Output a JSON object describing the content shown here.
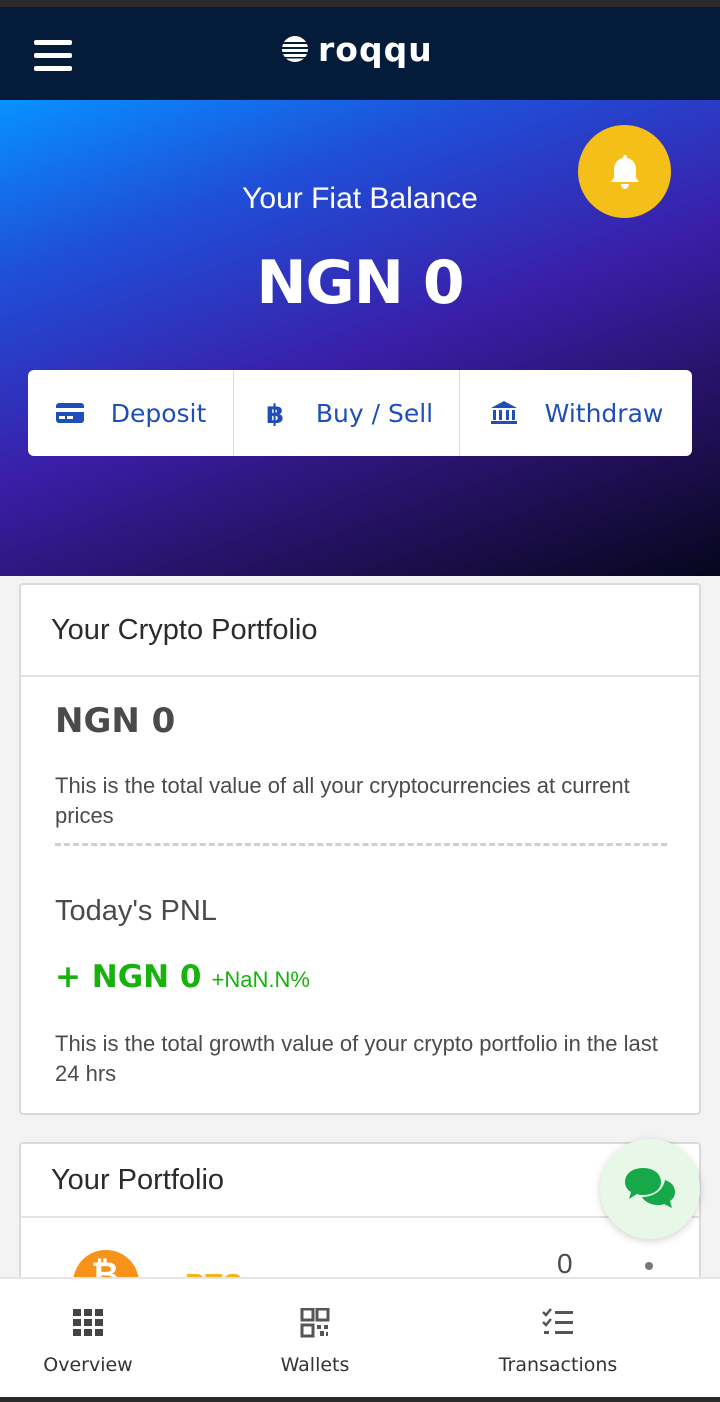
{
  "app": {
    "logo_text": "roqqu"
  },
  "header": {
    "menu_icon": "hamburger-menu-icon",
    "notification_icon": "bell-icon"
  },
  "hero": {
    "label": "Your Fiat Balance",
    "amount": "NGN 0"
  },
  "actions": [
    {
      "label": "Deposit",
      "icon": "credit-card-icon"
    },
    {
      "label": "Buy / Sell",
      "icon": "bitcoin-icon"
    },
    {
      "label": "Withdraw",
      "icon": "bank-icon"
    }
  ],
  "crypto_portfolio": {
    "title": "Your Crypto Portfolio",
    "amount": "NGN 0",
    "description": "This is the total value of all your cryptocurrencies at current prices",
    "pnl_label": "Today's PNL",
    "pnl_amount": "+ NGN 0",
    "pnl_percent": "+NaN.N%",
    "pnl_description": "This is the total growth value of your crypto portfolio in the last 24 hrs"
  },
  "portfolio": {
    "title": "Your Portfolio",
    "assets": [
      {
        "symbol": "BTC",
        "balance": "0"
      }
    ]
  },
  "bottom_nav": [
    {
      "label": "Overview",
      "icon": "grid-icon"
    },
    {
      "label": "Wallets",
      "icon": "qr-code-icon"
    },
    {
      "label": "Transactions",
      "icon": "checklist-icon"
    }
  ],
  "colors": {
    "navbar": "#041b3a",
    "accent_blue": "#1e4fb8",
    "bell_yellow": "#f5bf19",
    "pnl_green": "#18b20f",
    "btc_orange": "#f7931a"
  }
}
